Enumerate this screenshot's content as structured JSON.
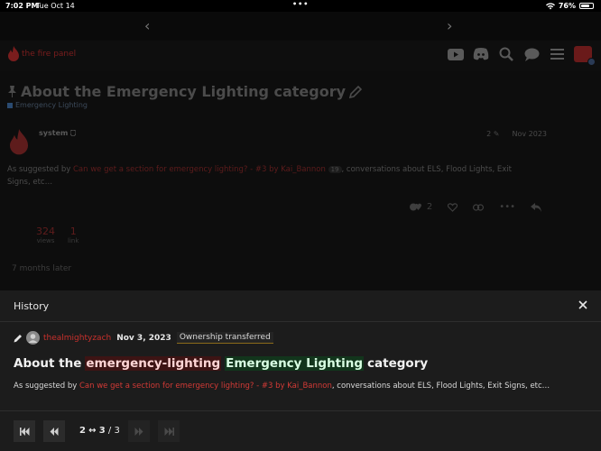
{
  "status": {
    "time": "7:02 PM",
    "date": "Tue Oct 14",
    "battery": "76%",
    "battery_level": 0.76
  },
  "site": {
    "name": "the fire panel"
  },
  "topic": {
    "title": "About the Emergency Lighting category",
    "category": "Emergency Lighting"
  },
  "post": {
    "username": "system",
    "edits": "2",
    "date": "Nov 2023",
    "body_prefix": "As suggested by ",
    "body_link": "Can we get a section for emergency lighting? - #3 by Kai_Bannon",
    "body_badge": "19",
    "body_suffix": ", conversations about ELS, Flood Lights, Exit",
    "body_line2": "Signs, etc…",
    "likes": "2"
  },
  "stats": {
    "views": {
      "value": "324",
      "label": "views"
    },
    "links": {
      "value": "1",
      "label": "link"
    }
  },
  "time_gap": "7 months later",
  "history": {
    "title": "History",
    "username": "thealmightyzach",
    "date": "Nov 3, 2023",
    "action": "Ownership transferred",
    "title_prefix": "About the",
    "title_deleted": "emergency-lighting",
    "title_inserted": "Emergency Lighting",
    "title_suffix": "category",
    "body_prefix": "As suggested by ",
    "body_link": "Can we get a section for emergency lighting? - #3 by Kai_Bannon",
    "body_suffix": ", conversations about ELS, Flood Lights, Exit Signs, etc…",
    "rev_from": "2",
    "rev_arrow": "↔",
    "rev_to": "3",
    "rev_total": "/ 3"
  },
  "colors": {
    "accent": "#c9302c",
    "modal_bg": "#1c1c1c",
    "diff_del": "#3d1414",
    "diff_ins": "#12351c"
  },
  "icons": [
    "wifi-icon",
    "battery-icon",
    "back-chevron-icon",
    "forward-chevron-icon",
    "flame-logo-icon",
    "youtube-icon",
    "discord-icon",
    "search-icon",
    "chat-icon",
    "menu-icon",
    "pin-icon",
    "pencil-icon",
    "like-icon",
    "heart-icon",
    "link-icon",
    "more-icon",
    "reply-icon",
    "close-icon",
    "first-icon",
    "prev-icon",
    "next-icon",
    "last-icon"
  ]
}
